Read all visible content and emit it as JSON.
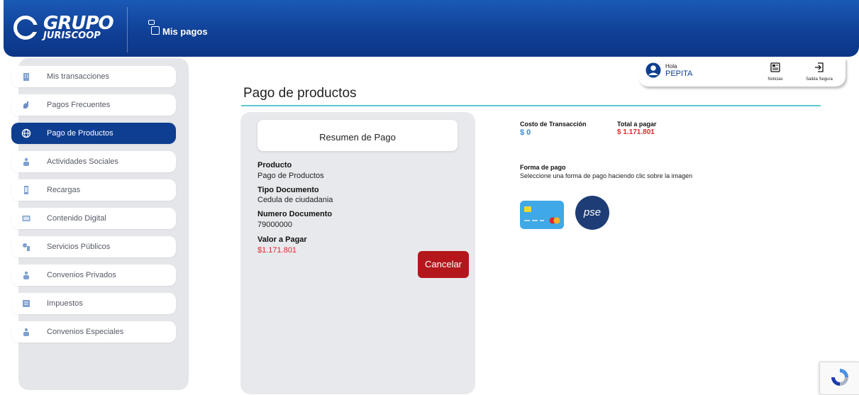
{
  "header": {
    "logo_main": "GRUPO",
    "logo_sub": "JURISCOOP",
    "app_title": "Mis pagos"
  },
  "user": {
    "greeting": "Hola",
    "name": "PEPITA",
    "news_label": "Noticias",
    "logout_label": "Salida Segura"
  },
  "sidebar": {
    "items": [
      {
        "label": "Mis transacciones",
        "icon": "building-icon",
        "active": false
      },
      {
        "label": "Pagos Frecuentes",
        "icon": "hand-icon",
        "active": false
      },
      {
        "label": "Pago de Productos",
        "icon": "globe-icon",
        "active": true
      },
      {
        "label": "Actividades Sociales",
        "icon": "people-icon",
        "active": false
      },
      {
        "label": "Recargas",
        "icon": "phone-icon",
        "active": false
      },
      {
        "label": "Contenido Digital",
        "icon": "screen-icon",
        "active": false
      },
      {
        "label": "Servicios Públicos",
        "icon": "utility-icon",
        "active": false
      },
      {
        "label": "Convenios Privados",
        "icon": "people-icon",
        "active": false
      },
      {
        "label": "Impuestos",
        "icon": "tax-icon",
        "active": false
      },
      {
        "label": "Convenios Especiales",
        "icon": "people-icon",
        "active": false
      }
    ]
  },
  "main": {
    "title": "Pago de productos",
    "summary": {
      "heading": "Resumen de Pago",
      "product_label": "Producto",
      "product_value": "Pago de Productos",
      "doc_type_label": "Tipo  Documento",
      "doc_type_value": "Cedula de ciudadania",
      "doc_number_label": "Numero Documento",
      "doc_number_value": "79000000",
      "amount_label": "Valor a Pagar",
      "amount_value": "$1.171.801",
      "cancel_label": "Cancelar"
    },
    "payment": {
      "cost_label": "Costo de Transacción",
      "cost_value": "$ 0",
      "total_label": "Total a pagar",
      "total_value": "$ 1.171.801",
      "method_label": "Forma de pago",
      "method_hint": "Seleccione una forma de pago haciendo clic sobre la imagen",
      "pse_text": "pse"
    }
  },
  "colors": {
    "brand_blue": "#0e3e8f",
    "accent_teal": "#5fc8cf",
    "danger_red": "#b3171c"
  }
}
